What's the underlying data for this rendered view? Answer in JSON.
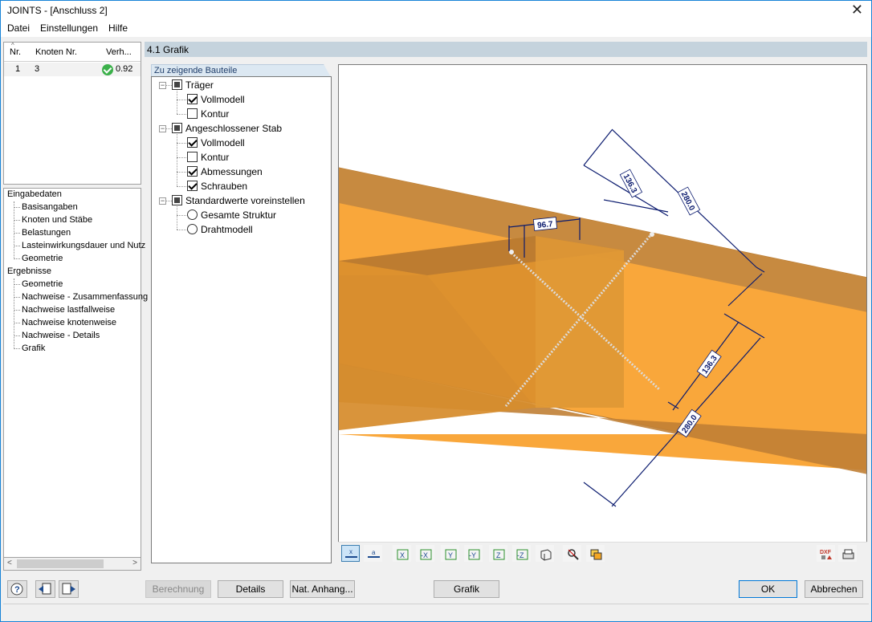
{
  "window": {
    "title": "JOINTS - [Anschluss 2]",
    "close_glyph": "✕"
  },
  "menu": [
    "Datei",
    "Einstellungen",
    "Hilfe"
  ],
  "result_table": {
    "headers": [
      "Nr.",
      "Knoten Nr.",
      "Verh..."
    ],
    "rows": [
      {
        "nr": "1",
        "knoten": "3",
        "verh": "0.92"
      }
    ]
  },
  "navigator": {
    "group1": "Eingabedaten",
    "group1_items": [
      "Basisangaben",
      "Knoten und Stäbe",
      "Belastungen",
      "Lasteinwirkungsdauer und Nutz",
      "Geometrie"
    ],
    "group2": "Ergebnisse",
    "group2_items": [
      "Geometrie",
      "Nachweise - Zusammenfassung",
      "Nachweise lastfallweise",
      "Nachweise knotenweise",
      "Nachweise - Details",
      "Grafik"
    ]
  },
  "section_title": "4.1 Grafik",
  "tree": {
    "tab_label": "Zu zeigende Bauteile",
    "traeger": "Träger",
    "traeger_vollmodell": "Vollmodell",
    "traeger_kontur": "Kontur",
    "stab": "Angeschlossener Stab",
    "stab_vollmodell": "Vollmodell",
    "stab_kontur": "Kontur",
    "stab_abmessungen": "Abmessungen",
    "stab_schrauben": "Schrauben",
    "standard": "Standardwerte voreinstellen",
    "gesamte_struktur": "Gesamte Struktur",
    "drahtmodell": "Drahtmodell"
  },
  "graphic": {
    "dim_top": "96.7",
    "dim_diag_a": "136.3",
    "dim_diag_b": "280.0",
    "dim_lower_a": "136.3",
    "dim_lower_b": "280.0",
    "toolbar_icons": [
      "view-x-icon",
      "view-a-icon",
      "view-x-axis-icon",
      "view-neg-x-icon",
      "view-y-icon",
      "view-neg-y-icon",
      "view-z-icon",
      "view-neg-z-icon",
      "iso-view-icon",
      "zoom-reset-icon",
      "render-options-icon",
      "dxf-export-icon",
      "print-icon"
    ],
    "dxf_label": "DXF"
  },
  "buttons": {
    "berechnung": "Berechnung",
    "details": "Details",
    "nat_anhang": "Nat. Anhang...",
    "grafik": "Grafik",
    "ok": "OK",
    "abbrechen": "Abbrechen"
  },
  "colors": {
    "beam_dark": "#c98a3a",
    "beam_light": "#fba93a",
    "dimension": "#0a1a6e",
    "accent": "#1883d7"
  }
}
